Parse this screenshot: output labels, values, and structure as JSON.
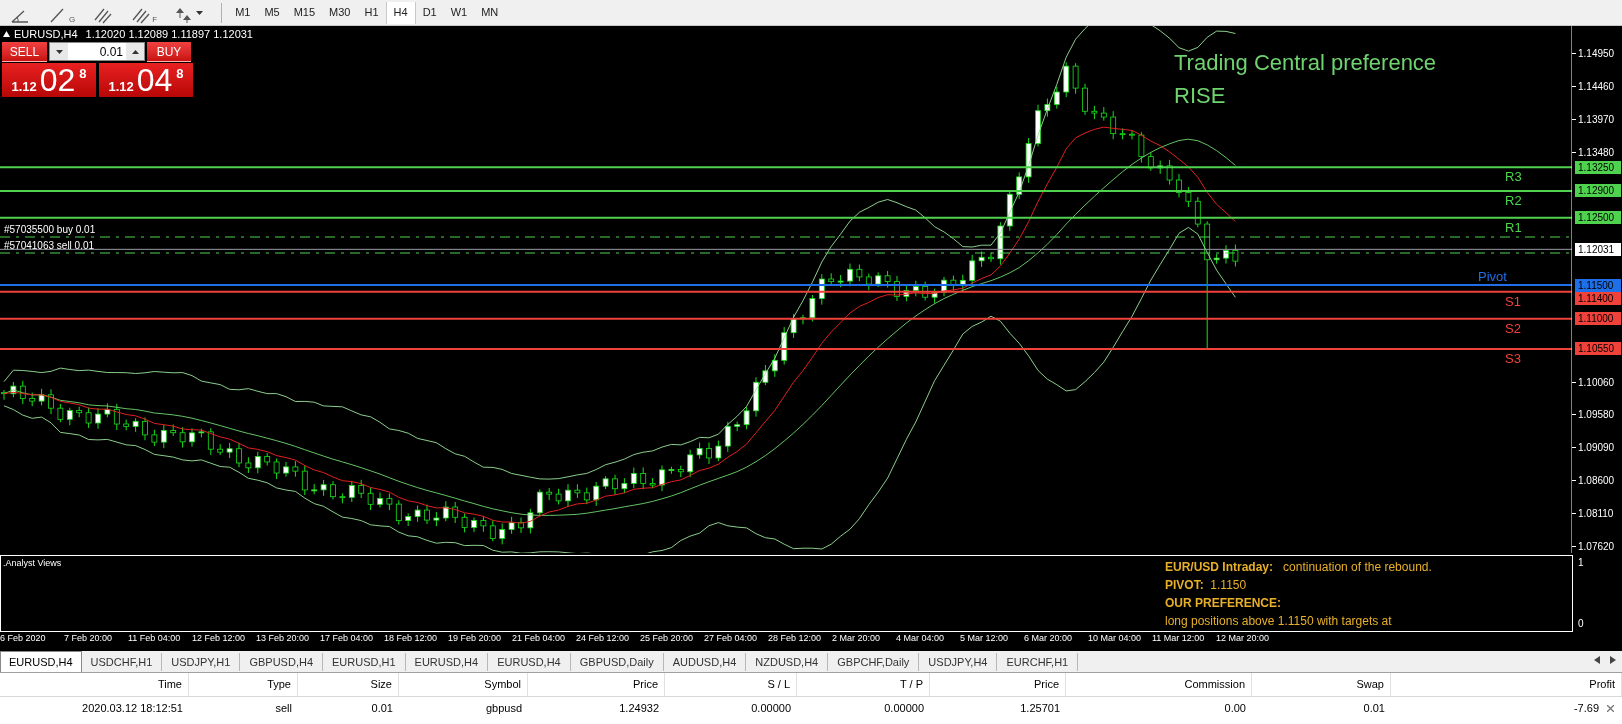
{
  "toolbar": {
    "tools": [
      {
        "kind": "angle"
      },
      {
        "kind": "line",
        "subscript": "G"
      },
      {
        "kind": "channel"
      },
      {
        "kind": "channel",
        "subscript": "F"
      },
      {
        "kind": "arrows"
      }
    ],
    "timeframes": [
      {
        "label": "M1",
        "selected": false
      },
      {
        "label": "M5",
        "selected": false
      },
      {
        "label": "M15",
        "selected": false
      },
      {
        "label": "M30",
        "selected": false
      },
      {
        "label": "H1",
        "selected": false
      },
      {
        "label": "H4",
        "selected": true
      },
      {
        "label": "D1",
        "selected": false
      },
      {
        "label": "W1",
        "selected": false
      },
      {
        "label": "MN",
        "selected": false
      }
    ]
  },
  "chart": {
    "symbol": "EURUSD,H4",
    "quotes": "1.12020 1.12089 1.11897 1.12031",
    "trade_panel": {
      "sell_label": "SELL",
      "buy_label": "BUY",
      "lot": "0.01",
      "sell_price": {
        "prefix": "1.12",
        "digits": "02",
        "last": "8"
      },
      "buy_price": {
        "prefix": "1.12",
        "digits": "04",
        "last": "8"
      }
    },
    "headline": [
      "Trading Central preference",
      "RISE"
    ],
    "orders": [
      {
        "label": "#57035500 buy 0.01"
      },
      {
        "label": "#57041063 sell 0.01"
      }
    ],
    "current_price": "1.12031",
    "levels": [
      {
        "label": "R3",
        "price": "1.13250",
        "color": "#4fd34f"
      },
      {
        "label": "R2",
        "price": "1.12900",
        "color": "#4fd34f"
      },
      {
        "label": "R1",
        "price": "1.12500",
        "color": "#4fd34f"
      },
      {
        "label": "Pivot",
        "price": "1.11500",
        "color": "#1f6fe8"
      },
      {
        "label": "S1",
        "price": "1.11400",
        "color": "#f0413a"
      },
      {
        "label": "S2",
        "price": "1.11000",
        "color": "#f0413a"
      },
      {
        "label": "S3",
        "price": "1.10550",
        "color": "#f0413a"
      }
    ],
    "price_ticks": [
      "1.14950",
      "1.14460",
      "1.13970",
      "1.13480",
      "1.10060",
      "1.09580",
      "1.09090",
      "1.08600",
      "1.08110",
      "1.07620"
    ],
    "time_labels": [
      "6 Feb 2020",
      "7 Feb 20:00",
      "11 Feb 04:00",
      "12 Feb 12:00",
      "13 Feb 20:00",
      "17 Feb 04:00",
      "18 Feb 12:00",
      "19 Feb 20:00",
      "21 Feb 04:00",
      "24 Feb 12:00",
      "25 Feb 20:00",
      "27 Feb 04:00",
      "28 Feb 12:00",
      "2 Mar 20:00",
      "4 Mar 04:00",
      "5 Mar 12:00",
      "6 Mar 20:00",
      "10 Mar 04:00",
      "11 Mar 12:00",
      "12 Mar 20:00"
    ]
  },
  "analyst_views": {
    "title": ".Analyst Views",
    "axis_ticks": [
      "1",
      "0"
    ],
    "lines": [
      "**EUR/USD Intraday:**   continuation of the rebound.",
      "**PIVOT:**  1.1150",
      "**OUR PREFERENCE:**",
      "long positions above 1.1150 with targets at"
    ]
  },
  "tabs": [
    {
      "label": "EURUSD,H4",
      "selected": true
    },
    {
      "label": "USDCHF,H1",
      "selected": false
    },
    {
      "label": "USDJPY,H1",
      "selected": false
    },
    {
      "label": "GBPUSD,H4",
      "selected": false
    },
    {
      "label": "EURUSD,H1",
      "selected": false
    },
    {
      "label": "EURUSD,H4",
      "selected": false
    },
    {
      "label": "EURUSD,H4",
      "selected": false
    },
    {
      "label": "GBPUSD,Daily",
      "selected": false
    },
    {
      "label": "AUDUSD,H4",
      "selected": false
    },
    {
      "label": "NZDUSD,H4",
      "selected": false
    },
    {
      "label": "GBPCHF,Daily",
      "selected": false
    },
    {
      "label": "USDJPY,H4",
      "selected": false
    },
    {
      "label": "EURCHF,H1",
      "selected": false
    }
  ],
  "trades_table": {
    "columns": [
      "Time",
      "Type",
      "Size",
      "Symbol",
      "Price",
      "S / L",
      "T / P",
      "Price",
      "Commission",
      "Swap",
      "Profit"
    ],
    "rows": [
      [
        "2020.03.12 18:12:51",
        "sell",
        "0.01",
        "gbpusd",
        "1.24932",
        "0.00000",
        "0.00000",
        "1.25701",
        "0.00",
        "0.01",
        "-7.69"
      ]
    ]
  }
}
